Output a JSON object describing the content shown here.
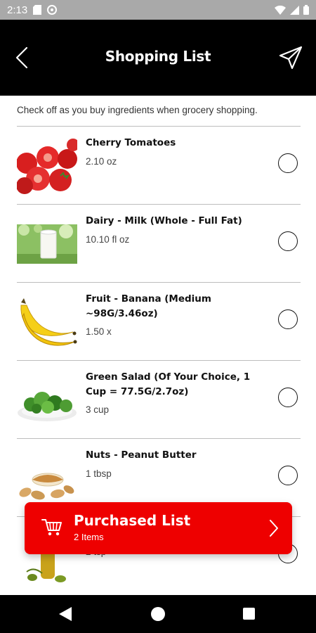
{
  "status_bar": {
    "time": "2:13",
    "icons": [
      "sd-card-icon",
      "sync-icon",
      "wifi-icon",
      "cellular-icon",
      "battery-icon"
    ]
  },
  "app_bar": {
    "title": "Shopping List",
    "back_icon": "back-arrow-icon",
    "send_icon": "send-icon"
  },
  "subtitle": "Check off as you buy ingredients when grocery shopping.",
  "items": [
    {
      "name": "Cherry Tomatoes",
      "qty": "2.10 oz",
      "image": "cherry-tomatoes-image",
      "checked": false
    },
    {
      "name": "Dairy - Milk (Whole - Full Fat)",
      "qty": "10.10 fl oz",
      "image": "milk-image",
      "checked": false
    },
    {
      "name": "Fruit - Banana (Medium ~98G/3.46oz)",
      "qty": "1.50 x",
      "image": "banana-image",
      "checked": false
    },
    {
      "name": "Green Salad (Of Your Choice, 1 Cup = 77.5G/2.7oz)",
      "qty": "3 cup",
      "image": "green-salad-image",
      "checked": false
    },
    {
      "name": "Nuts - Peanut Butter",
      "qty": "1 tbsp",
      "image": "peanut-butter-image",
      "checked": false
    },
    {
      "name": "",
      "qty": "2 tsp",
      "image": "olive-oil-image",
      "checked": false
    }
  ],
  "purchased": {
    "title": "Purchased List",
    "count": "2 Items",
    "cart_icon": "cart-icon",
    "chevron_icon": "chevron-right-icon"
  },
  "colors": {
    "accent": "#ee0000",
    "header": "#000000",
    "status_bar": "#a9a9a9"
  }
}
